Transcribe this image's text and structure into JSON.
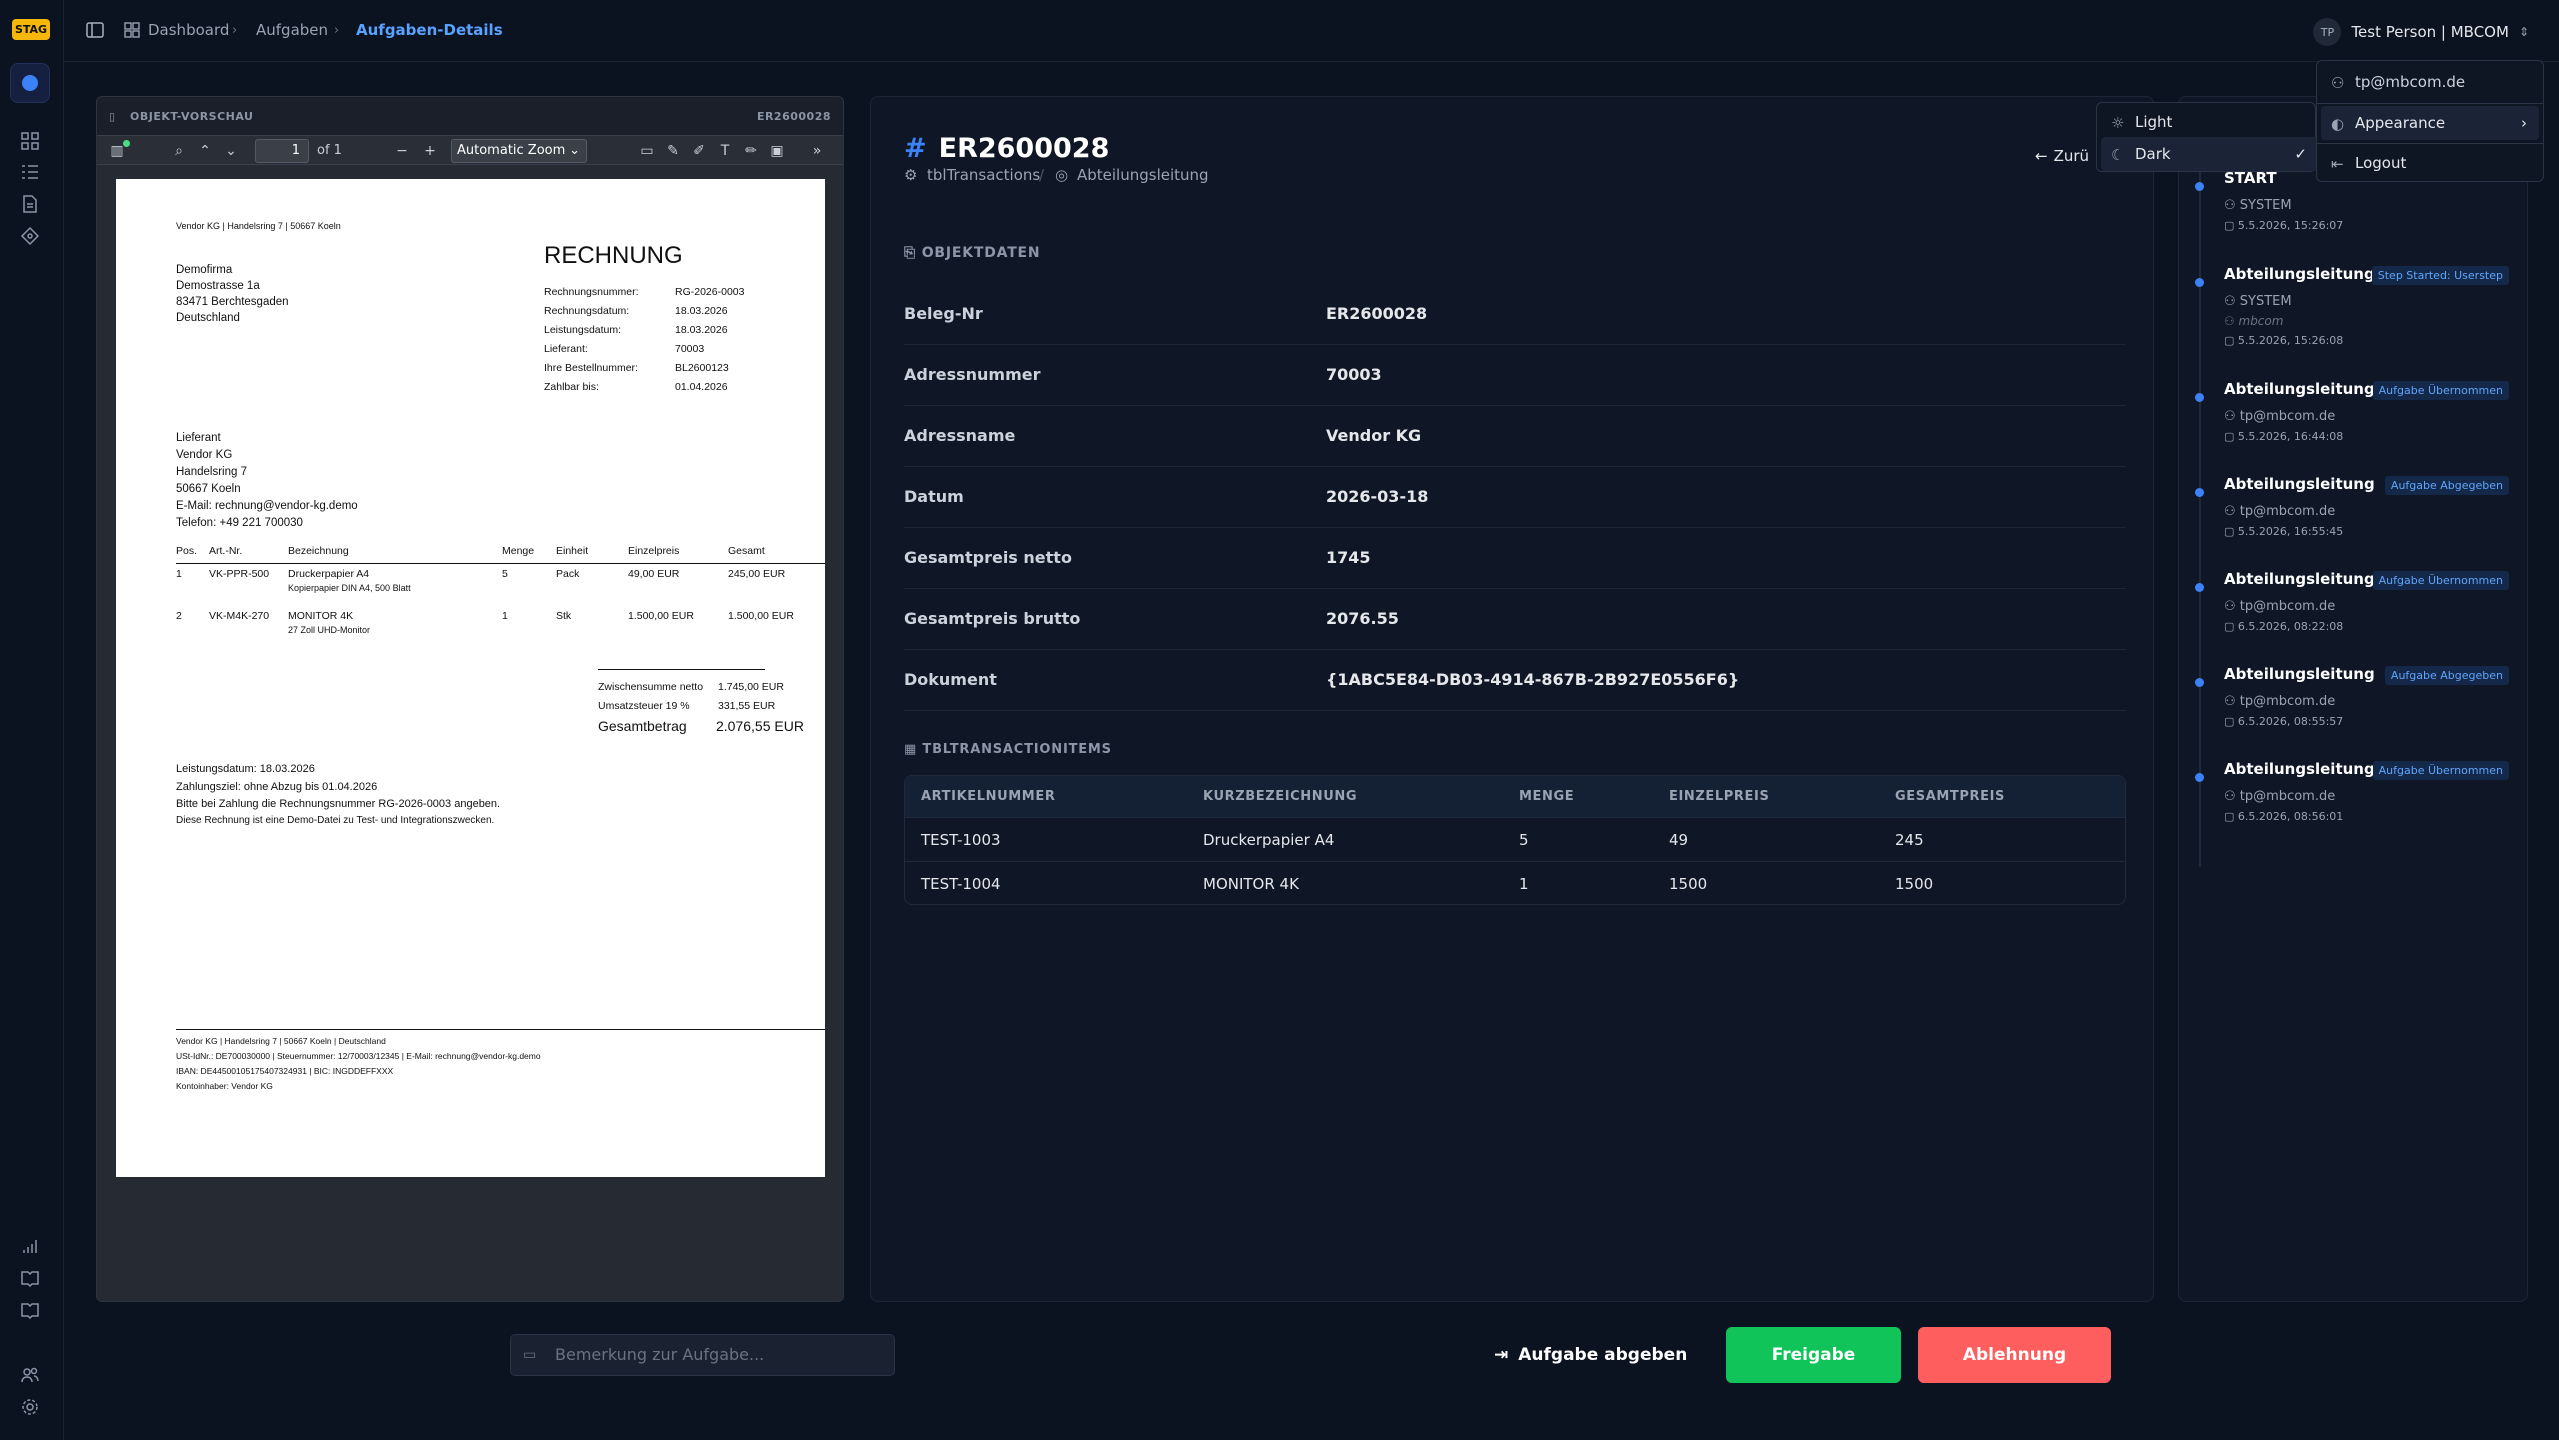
{
  "env_badge": "STAG",
  "breadcrumb": [
    "Dashboard",
    "Aufgaben",
    "Aufgaben-Details"
  ],
  "user": {
    "initials": "TP",
    "name": "Test Person | MBCOM",
    "email": "tp@mbcom.de"
  },
  "user_menu": {
    "appearance": "Appearance",
    "logout": "Logout"
  },
  "appearance_menu": {
    "light": "Light",
    "dark": "Dark",
    "selected": "Dark"
  },
  "preview": {
    "title": "OBJEKT-VORSCHAU",
    "doc_id": "ER2600028",
    "page_num": "1",
    "page_total": "of 1",
    "zoom": "Automatic Zoom"
  },
  "invoice": {
    "sender_line": "Vendor KG | Handelsring 7 | 50667 Koeln",
    "recipient": [
      "Demofirma",
      "Demostrasse 1a",
      "83471 Berchtesgaden",
      "Deutschland"
    ],
    "title": "RECHNUNG",
    "meta_labels": [
      "Rechnungsnummer:",
      "Rechnungsdatum:",
      "Leistungsdatum:",
      "Lieferant:",
      "Ihre Bestellnummer:",
      "Zahlbar bis:"
    ],
    "meta_values": [
      "RG-2026-0003",
      "18.03.2026",
      "18.03.2026",
      "70003",
      "BL2600123",
      "01.04.2026"
    ],
    "supplier": [
      "Lieferant",
      "Vendor KG",
      "Handelsring 7",
      "50667 Koeln",
      "E-Mail: rechnung@vendor-kg.demo",
      "Telefon: +49 221 700030"
    ],
    "table_headers": [
      "Pos.",
      "Art.-Nr.",
      "Bezeichnung",
      "Menge",
      "Einheit",
      "Einzelpreis",
      "Gesamt"
    ],
    "rows": [
      {
        "pos": "1",
        "art": "VK-PPR-500",
        "name": "Druckerpapier A4",
        "desc": "Kopierpapier DIN A4, 500 Blatt",
        "qty": "5",
        "unit": "Pack",
        "price": "49,00 EUR",
        "total": "245,00 EUR"
      },
      {
        "pos": "2",
        "art": "VK-M4K-270",
        "name": "MONITOR 4K",
        "desc": "27 Zoll UHD-Monitor",
        "qty": "1",
        "unit": "Stk",
        "price": "1.500,00 EUR",
        "total": "1.500,00 EUR"
      }
    ],
    "net_label": "Zwischensumme netto",
    "net_value": "1.745,00 EUR",
    "vat_label": "Umsatzsteuer 19 %",
    "vat_value": "331,55 EUR",
    "gross_label": "Gesamtbetrag",
    "gross_value": "2.076,55 EUR",
    "notes": [
      "Leistungsdatum: 18.03.2026",
      "Zahlungsziel: ohne Abzug bis 01.04.2026",
      "Bitte bei Zahlung die Rechnungsnummer RG-2026-0003 angeben.",
      "Diese Rechnung ist eine Demo-Datei zu Test- und Integrationszwecken."
    ],
    "footer": [
      "Vendor KG | Handelsring 7 | 50667 Koeln | Deutschland",
      "USt-IdNr.: DE700030000 | Steuernummer: 12/70003/12345 | E-Mail: rechnung@vendor-kg.demo",
      "IBAN: DE44500105175407324931 | BIC: INGDDEFFXXX",
      "Kontoinhaber: Vendor KG"
    ]
  },
  "object": {
    "id": "ER2600028",
    "source": "tblTransactions",
    "step": "Abteilungsleitung",
    "back_label": "Zurü",
    "section_title": "OBJEKTDATEN",
    "fields": [
      {
        "label": "Beleg-Nr",
        "value": "ER2600028"
      },
      {
        "label": "Adressnummer",
        "value": "70003"
      },
      {
        "label": "Adressname",
        "value": "Vendor KG"
      },
      {
        "label": "Datum",
        "value": "2026-03-18"
      },
      {
        "label": "Gesamtpreis netto",
        "value": "1745"
      },
      {
        "label": "Gesamtpreis brutto",
        "value": "2076.55"
      },
      {
        "label": "Dokument",
        "value": "{1ABC5E84-DB03-4914-867B-2B927E0556F6}"
      }
    ],
    "items_title": "TBLTRANSACTIONITEMS",
    "items_headers": [
      "ARTIKELNUMMER",
      "KURZBEZEICHNUNG",
      "MENGE",
      "EINZELPREIS",
      "GESAMTPREIS"
    ],
    "items": [
      [
        "TEST-1003",
        "Druckerpapier A4",
        "5",
        "49",
        "245"
      ],
      [
        "TEST-1004",
        "MONITOR 4K",
        "1",
        "1500",
        "1500"
      ]
    ]
  },
  "timeline": [
    {
      "name": "START",
      "badge": "",
      "user": "SYSTEM",
      "org": "",
      "time": "5.5.2026, 15:26:07"
    },
    {
      "name": "Abteilungsleitung",
      "badge": "Step Started: Userstep",
      "user": "SYSTEM",
      "org": "mbcom",
      "time": "5.5.2026, 15:26:08"
    },
    {
      "name": "Abteilungsleitung",
      "badge": "Aufgabe Übernommen",
      "user": "tp@mbcom.de",
      "org": "",
      "time": "5.5.2026, 16:44:08"
    },
    {
      "name": "Abteilungsleitung",
      "badge": "Aufgabe Abgegeben",
      "user": "tp@mbcom.de",
      "org": "",
      "time": "5.5.2026, 16:55:45"
    },
    {
      "name": "Abteilungsleitung",
      "badge": "Aufgabe Übernommen",
      "user": "tp@mbcom.de",
      "org": "",
      "time": "6.5.2026, 08:22:08"
    },
    {
      "name": "Abteilungsleitung",
      "badge": "Aufgabe Abgegeben",
      "user": "tp@mbcom.de",
      "org": "",
      "time": "6.5.2026, 08:55:57"
    },
    {
      "name": "Abteilungsleitung",
      "badge": "Aufgabe Übernommen",
      "user": "tp@mbcom.de",
      "org": "",
      "time": "6.5.2026, 08:56:01"
    }
  ],
  "actions": {
    "remark_placeholder": "Bemerkung zur Aufgabe...",
    "hand_back": "Aufgabe abgeben",
    "approve": "Freigabe",
    "reject": "Ablehnung"
  },
  "colors": {
    "accent": "#3b82f6",
    "approve": "#10c45a",
    "reject": "#ff5e5e",
    "env": "#f5b70a"
  }
}
